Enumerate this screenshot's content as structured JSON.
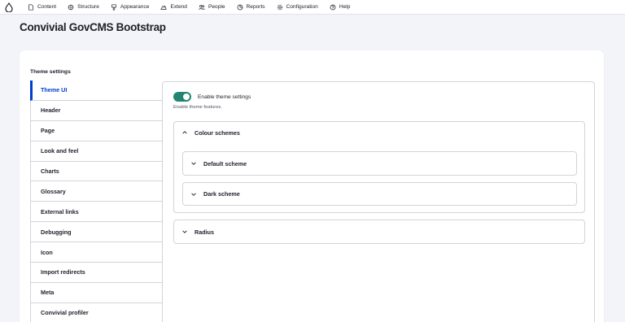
{
  "toolbar": {
    "logo_icon": "drupal-drop-icon",
    "items": [
      {
        "label": "Content",
        "icon": "page-icon"
      },
      {
        "label": "Structure",
        "icon": "structure-icon"
      },
      {
        "label": "Appearance",
        "icon": "brush-icon"
      },
      {
        "label": "Extend",
        "icon": "puzzle-icon"
      },
      {
        "label": "People",
        "icon": "people-icon"
      },
      {
        "label": "Reports",
        "icon": "chart-icon"
      },
      {
        "label": "Configuration",
        "icon": "gear-icon"
      },
      {
        "label": "Help",
        "icon": "help-icon"
      }
    ]
  },
  "page": {
    "title": "Convivial GovCMS Bootstrap"
  },
  "theme_settings": {
    "section_label": "Theme settings",
    "tabs": [
      {
        "label": "Theme UI",
        "active": true
      },
      {
        "label": "Header"
      },
      {
        "label": "Page"
      },
      {
        "label": "Look and feel"
      },
      {
        "label": "Charts"
      },
      {
        "label": "Glossary"
      },
      {
        "label": "External links"
      },
      {
        "label": "Debugging"
      },
      {
        "label": "Icon"
      },
      {
        "label": "Import redirects"
      },
      {
        "label": "Meta"
      },
      {
        "label": "Convivial profiler"
      }
    ],
    "pane": {
      "toggle_label": "Enable theme settings",
      "toggle_on": true,
      "toggle_description": "Enable theme features.",
      "colour_schemes": {
        "label": "Colour schemes",
        "expanded": true,
        "items": [
          {
            "label": "Default scheme"
          },
          {
            "label": "Dark scheme"
          }
        ]
      },
      "radius": {
        "label": "Radius",
        "expanded": false
      }
    }
  },
  "colors": {
    "accent": "#003ecc",
    "toggle_on": "#228572",
    "background": "#f3f4f9"
  }
}
